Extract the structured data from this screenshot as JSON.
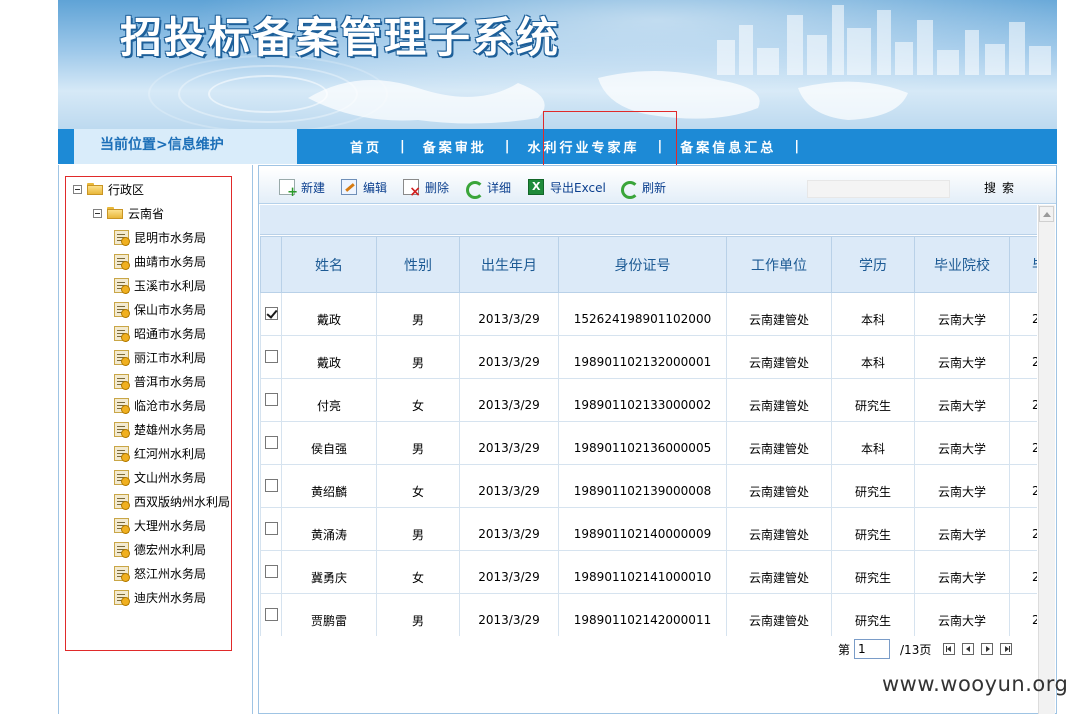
{
  "banner": {
    "title": "招投标备案管理子系统"
  },
  "nav": {
    "location": "当前位置>信息维护",
    "items": [
      "首页",
      "备案审批",
      "水利行业专家库",
      "备案信息汇总"
    ],
    "separator": "|"
  },
  "tree": {
    "root": "行政区",
    "province": "云南省",
    "leaves": [
      "昆明市水务局",
      "曲靖市水务局",
      "玉溪市水利局",
      "保山市水务局",
      "昭通市水务局",
      "丽江市水利局",
      "普洱市水务局",
      "临沧市水务局",
      "楚雄州水务局",
      "红河州水利局",
      "文山州水务局",
      "西双版纳州水利局",
      "大理州水务局",
      "德宏州水利局",
      "怒江州水务局",
      "迪庆州水务局"
    ]
  },
  "toolbar": {
    "new": "新建",
    "edit": "编辑",
    "delete": "删除",
    "detail": "详细",
    "export": "导出Excel",
    "refresh": "刷新",
    "search_value": "",
    "search_button": "搜索"
  },
  "table": {
    "columns": [
      "姓名",
      "性别",
      "出生年月",
      "身份证号",
      "工作单位",
      "学历",
      "毕业院校",
      "毕"
    ],
    "rows": [
      {
        "checked": true,
        "name": "戴政",
        "gender": "男",
        "birth": "2013/3/29",
        "id": "152624198901102000",
        "unit": "云南建管处",
        "edu": "本科",
        "school": "云南大学",
        "extra": "2"
      },
      {
        "checked": false,
        "name": "戴政",
        "gender": "男",
        "birth": "2013/3/29",
        "id": "198901102132000001",
        "unit": "云南建管处",
        "edu": "本科",
        "school": "云南大学",
        "extra": "2"
      },
      {
        "checked": false,
        "name": "付亮",
        "gender": "女",
        "birth": "2013/3/29",
        "id": "198901102133000002",
        "unit": "云南建管处",
        "edu": "研究生",
        "school": "云南大学",
        "extra": "2"
      },
      {
        "checked": false,
        "name": "侯自强",
        "gender": "男",
        "birth": "2013/3/29",
        "id": "198901102136000005",
        "unit": "云南建管处",
        "edu": "本科",
        "school": "云南大学",
        "extra": "2"
      },
      {
        "checked": false,
        "name": "黄绍麟",
        "gender": "女",
        "birth": "2013/3/29",
        "id": "198901102139000008",
        "unit": "云南建管处",
        "edu": "研究生",
        "school": "云南大学",
        "extra": "2"
      },
      {
        "checked": false,
        "name": "黄涌涛",
        "gender": "男",
        "birth": "2013/3/29",
        "id": "198901102140000009",
        "unit": "云南建管处",
        "edu": "研究生",
        "school": "云南大学",
        "extra": "2"
      },
      {
        "checked": false,
        "name": "冀勇庆",
        "gender": "女",
        "birth": "2013/3/29",
        "id": "198901102141000010",
        "unit": "云南建管处",
        "edu": "研究生",
        "school": "云南大学",
        "extra": "2"
      },
      {
        "checked": false,
        "name": "贾鹏雷",
        "gender": "男",
        "birth": "2013/3/29",
        "id": "198901102142000011",
        "unit": "云南建管处",
        "edu": "研究生",
        "school": "云南大学",
        "extra": "2"
      }
    ]
  },
  "pager": {
    "prefix": "第",
    "page": "1",
    "total": "/13页"
  },
  "watermark": "www.wooyun.org"
}
